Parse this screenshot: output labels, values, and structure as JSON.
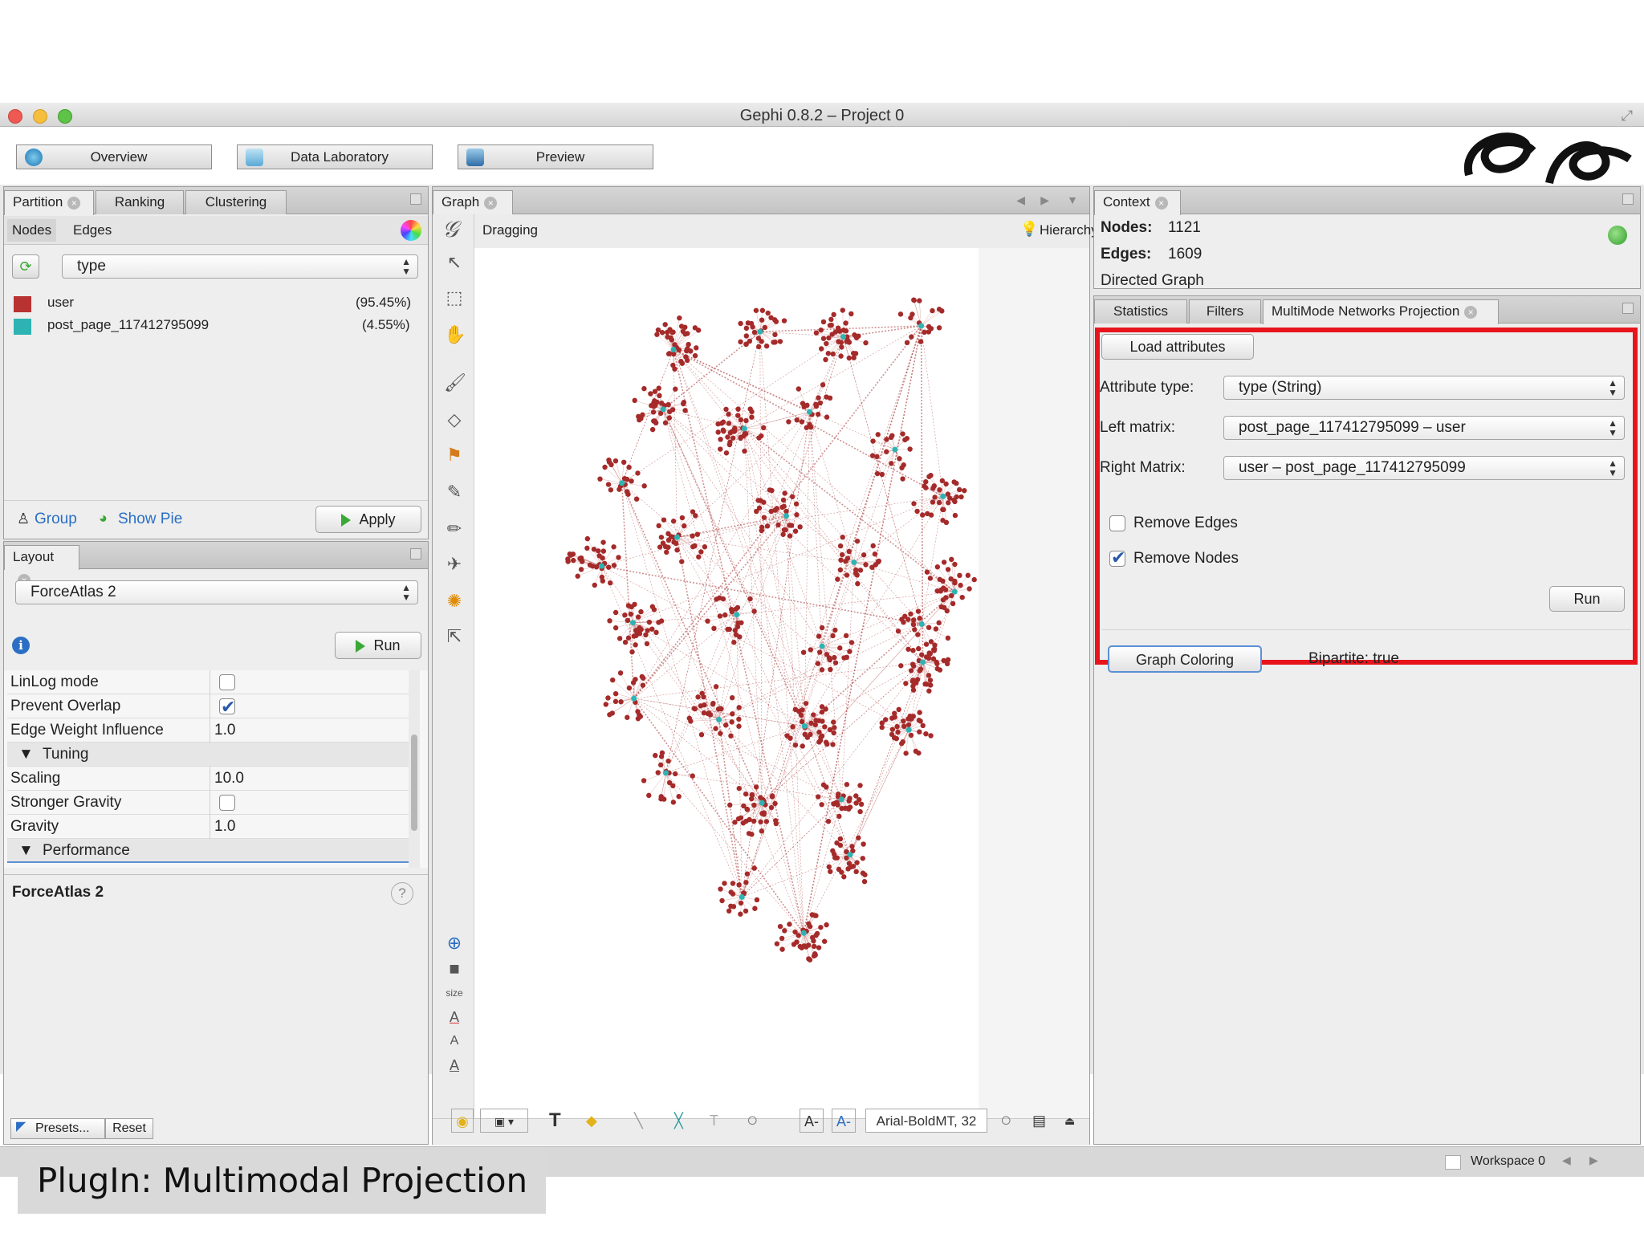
{
  "window": {
    "title": "Gephi 0.8.2 – Project 0",
    "toolbar": {
      "overview": "Overview",
      "data_laboratory": "Data Laboratory",
      "preview": "Preview"
    }
  },
  "partition_panel": {
    "tabs": [
      "Partition",
      "Ranking",
      "Clustering"
    ],
    "subtabs": [
      "Nodes",
      "Edges"
    ],
    "attribute": "type",
    "items": [
      {
        "label": "user",
        "pct": "(95.45%)",
        "color": "#b83232"
      },
      {
        "label": "post_page_117412795099",
        "pct": "(4.55%)",
        "color": "#2eb3b3"
      }
    ],
    "group": "Group",
    "show_pie": "Show Pie",
    "apply": "Apply"
  },
  "layout_panel": {
    "tab": "Layout",
    "algorithm": "ForceAtlas 2",
    "run": "Run",
    "properties": [
      {
        "key": "LinLog mode",
        "type": "checkbox",
        "checked": false
      },
      {
        "key": "Prevent Overlap",
        "type": "checkbox",
        "checked": true
      },
      {
        "key": "Edge Weight Influence",
        "type": "value",
        "value": "1.0"
      },
      {
        "key": "Tuning",
        "type": "section"
      },
      {
        "key": "Scaling",
        "type": "value",
        "value": "10.0"
      },
      {
        "key": "Stronger Gravity",
        "type": "checkbox",
        "checked": false
      },
      {
        "key": "Gravity",
        "type": "value",
        "value": "1.0"
      },
      {
        "key": "Performance",
        "type": "section"
      }
    ],
    "description_title": "ForceAtlas 2",
    "presets": "Presets...",
    "reset": "Reset"
  },
  "graph_panel": {
    "tab": "Graph",
    "mode": "Dragging",
    "hierarchy": "Hierarchy",
    "font_label": "Arial-BoldMT, 32",
    "size_label": "size",
    "node_color": "#a52a2a",
    "edge_color": "#b04848",
    "highlight_color": "#2eb3b3"
  },
  "context_panel": {
    "tab": "Context",
    "nodes_label": "Nodes:",
    "nodes_value": "1121",
    "edges_label": "Edges:",
    "edges_value": "1609",
    "graph_type": "Directed Graph"
  },
  "projection_panel": {
    "tabs": [
      "Statistics",
      "Filters",
      "MultiMode Networks Projection"
    ],
    "load_attributes": "Load attributes",
    "attribute_type_label": "Attribute type:",
    "attribute_type_value": "type (String)",
    "left_matrix_label": "Left matrix:",
    "left_matrix_value": "post_page_117412795099 – user",
    "right_matrix_label": "Right Matrix:",
    "right_matrix_value": "user – post_page_117412795099",
    "remove_edges": "Remove Edges",
    "remove_edges_checked": false,
    "remove_nodes": "Remove Nodes",
    "remove_nodes_checked": true,
    "run": "Run",
    "graph_coloring": "Graph Coloring",
    "bipartite": "Bipartite: true",
    "highlight_border": "#e8141c"
  },
  "status_bar": {
    "workspace": "Workspace 0"
  },
  "caption": "PlugIn: Multimodal Projection"
}
